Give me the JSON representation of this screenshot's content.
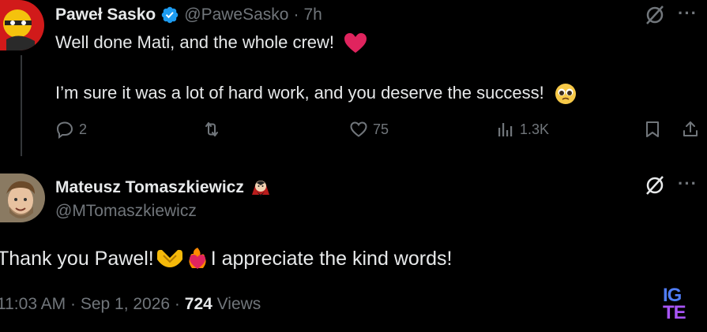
{
  "tweet1": {
    "author_name": "Paweł Sasko",
    "author_handle": "@PaweSasko",
    "separator": "·",
    "time_ago": "7h",
    "line1": "Well done Mati, and the whole crew!",
    "line2": "I’m sure it was a lot of hard work, and you deserve the success!",
    "actions": {
      "replies": "2",
      "likes": "75",
      "views": "1.3K"
    },
    "more_label": "···"
  },
  "tweet2": {
    "author_name": "Mateusz Tomaszkiewicz",
    "author_handle": "@MTomaszkiewicz",
    "text_part1": "Thank you Pawel!",
    "text_part2": "I appreciate the kind words!",
    "timestamp": "11:03 AM · Sep 1, 2026 · ",
    "view_count": "724",
    "views_label": " Views",
    "more_label": "···"
  },
  "watermark": {
    "line1": "IG",
    "line2": "TE"
  },
  "colors": {
    "background": "#000000",
    "text_primary": "#e7e9ea",
    "text_secondary": "#71767b",
    "verified": "#1d9bf0",
    "heart": "#f91880",
    "logo_top": "#3b82f6",
    "logo_bottom": "#a855f7"
  }
}
